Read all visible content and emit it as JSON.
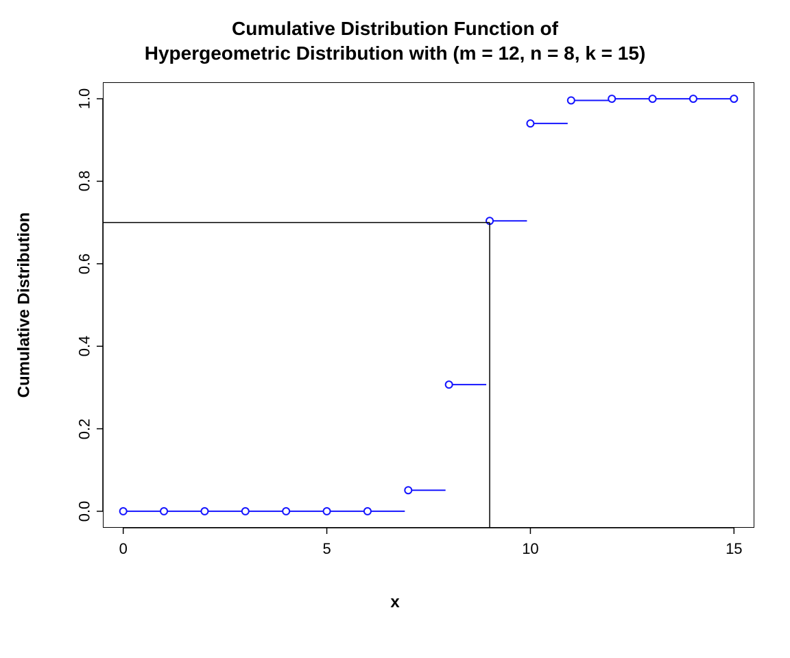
{
  "chart_data": {
    "type": "line",
    "title_line1": "Cumulative Distribution Function of",
    "title_line2": "Hypergeometric Distribution with (m = 12, n = 8, k = 15)",
    "xlabel": "x",
    "ylabel": "Cumulative Distribution",
    "xlim": [
      -0.5,
      15.5
    ],
    "ylim": [
      -0.04,
      1.04
    ],
    "x_ticks": [
      0,
      5,
      10,
      15
    ],
    "y_ticks": [
      0.0,
      0.2,
      0.4,
      0.6,
      0.8,
      1.0
    ],
    "point_color": "#1414ff",
    "point_radius": 5,
    "line_width": 2,
    "step_points": [
      {
        "x": 0,
        "y": 0.0
      },
      {
        "x": 1,
        "y": 0.0
      },
      {
        "x": 2,
        "y": 0.0
      },
      {
        "x": 3,
        "y": 0.0
      },
      {
        "x": 4,
        "y": 0.0
      },
      {
        "x": 5,
        "y": 0.0
      },
      {
        "x": 6,
        "y": 0.0
      },
      {
        "x": 7,
        "y": 0.051
      },
      {
        "x": 8,
        "y": 0.307
      },
      {
        "x": 9,
        "y": 0.704
      },
      {
        "x": 10,
        "y": 0.94
      },
      {
        "x": 11,
        "y": 0.996
      },
      {
        "x": 12,
        "y": 1.0
      },
      {
        "x": 13,
        "y": 1.0
      },
      {
        "x": 14,
        "y": 1.0
      },
      {
        "x": 15,
        "y": 1.0
      }
    ],
    "reference_lines": {
      "y_value": 0.7,
      "x_value": 9
    }
  }
}
